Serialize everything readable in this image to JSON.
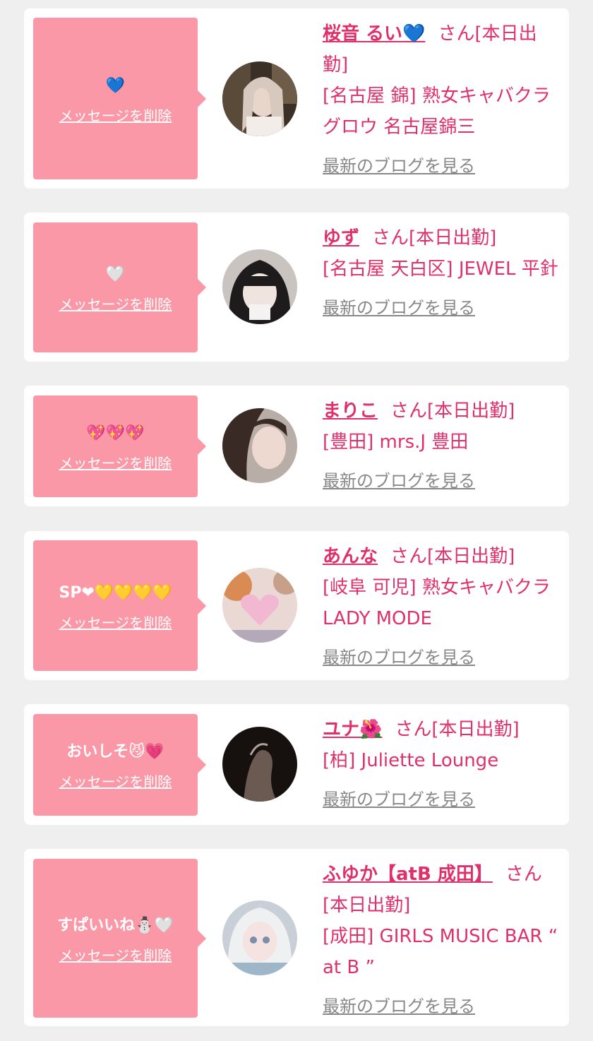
{
  "delete_label": "メッセージを削除",
  "blog_label": "最新のブログを見る",
  "cards": [
    {
      "emoji_text": "💙",
      "name": "桜音 るい💙",
      "honorific": "さん",
      "status": "[本日出勤]",
      "location": "[名古屋 錦] 熟女キャバクラグロウ 名古屋錦三"
    },
    {
      "emoji_text": "🤍",
      "name": "ゆず",
      "honorific": "さん",
      "status": "[本日出勤]",
      "location": "[名古屋 天白区] JEWEL 平針"
    },
    {
      "emoji_text": "💖💖💖",
      "name": "まりこ",
      "honorific": "さん",
      "status": "[本日出勤]",
      "location": "[豊田] mrs.J 豊田"
    },
    {
      "emoji_text": "SP❤💛💛💛💛",
      "name": "あんな",
      "honorific": "さん",
      "status": "[本日出勤]",
      "location": "[岐阜 可児] 熟女キャバクラ LADY MODE"
    },
    {
      "emoji_text": "おいしそ😼💗",
      "name": "ユナ🌺",
      "honorific": "さん",
      "status": "[本日出勤]",
      "location": "[柏] Juliette Lounge"
    },
    {
      "emoji_text": "すぱいいね⛄🤍",
      "name": "ふゆか【atB 成田】",
      "honorific": "さん",
      "status": "[本日出勤]",
      "location": "[成田] GIRLS MUSIC BAR “ at B ”"
    }
  ],
  "colors": {
    "bubble": "#fa98a7",
    "accent": "#e0306a",
    "link_gray": "#888888",
    "background": "#efefef"
  }
}
